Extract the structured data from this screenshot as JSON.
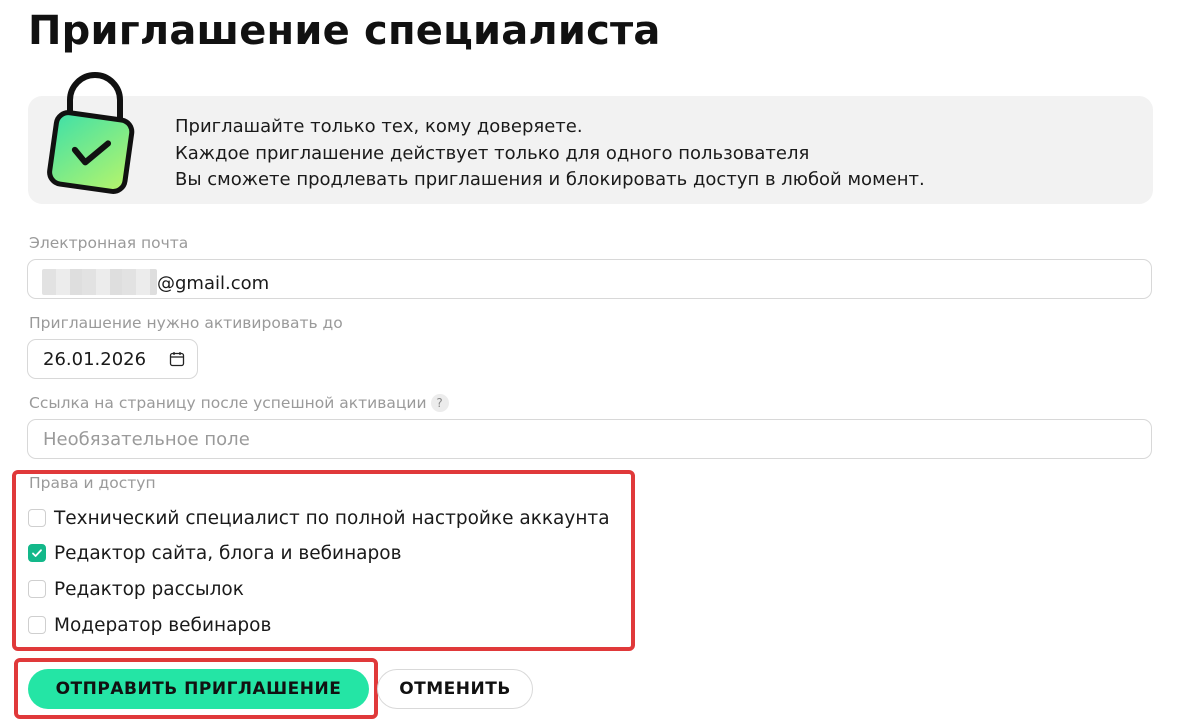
{
  "page": {
    "title": "Приглашение специалиста"
  },
  "notice": {
    "lines": [
      "Приглашайте только тех, кому доверяете.",
      "Каждое приглашение действует только для одного пользователя",
      "Вы сможете продлевать приглашения и блокировать доступ в любой момент."
    ]
  },
  "form": {
    "email": {
      "label": "Электронная почта",
      "value": "@gmail.com"
    },
    "expiry": {
      "label": "Приглашение нужно активировать до",
      "value": "26.01.2026"
    },
    "redirect": {
      "label": "Ссылка на страницу после успешной активации",
      "help": "?",
      "placeholder": "Необязательное поле",
      "value": ""
    },
    "rights": {
      "label": "Права и доступ",
      "options": [
        {
          "label": "Технический специалист по полной настройке аккаунта",
          "checked": false
        },
        {
          "label": "Редактор сайта, блога и вебинаров",
          "checked": true
        },
        {
          "label": "Редактор рассылок",
          "checked": false
        },
        {
          "label": "Модератор вебинаров",
          "checked": false
        }
      ]
    }
  },
  "actions": {
    "submit_label": "ОТПРАВИТЬ ПРИГЛАШЕНИЕ",
    "cancel_label": "ОТМЕНИТЬ"
  },
  "colors": {
    "accent": "#24e5a5",
    "checkbox": "#13b88a",
    "highlight": "#e0393a",
    "notice_bg": "#f2f2f2"
  },
  "icons": {
    "lock": "lock-check-icon",
    "calendar": "calendar-icon",
    "help": "question-icon"
  }
}
